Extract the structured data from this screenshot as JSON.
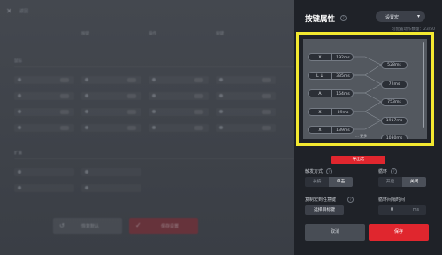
{
  "background": {
    "close_glyph": "✕",
    "title": "返回",
    "columns": [
      "按键",
      "",
      "操作",
      "",
      "按键"
    ],
    "section1": "鼠标",
    "section2": "扩展",
    "reset_label": "恢复默认",
    "save_label": "保存设置"
  },
  "panel": {
    "title": "按键属性",
    "profile_dropdown": "设置宏",
    "count_text": "可配置动作数量：23/50",
    "preview": {
      "keys": [
        {
          "key": "X",
          "time": "192ms"
        },
        {
          "key": "L ↓",
          "time": "335ms"
        },
        {
          "key": "A",
          "time": "154ms"
        },
        {
          "key": "X",
          "time": "89ms"
        },
        {
          "key": "X",
          "time": "139ms"
        }
      ],
      "intervals": [
        "528ms",
        "72ms",
        "753ms",
        "1917ms",
        "1030ms"
      ],
      "cut_label": "... 更多"
    },
    "export_label": "导出宏",
    "trigger": {
      "label": "触发方式",
      "options": [
        "长按",
        "单击"
      ],
      "selected": "单击"
    },
    "loop": {
      "label": "循环",
      "options": [
        "开启",
        "关闭"
      ],
      "selected": "关闭"
    },
    "copy": {
      "label": "复制宏到任意键",
      "button": "选择目标键"
    },
    "loop_interval": {
      "label": "循环间隔时间",
      "value": "0",
      "unit": "ms"
    },
    "cancel_label": "取消",
    "save_label": "保存"
  },
  "colors": {
    "accent": "#e0262e",
    "highlight": "#f3e930",
    "panel_bg": "#1f2228"
  }
}
